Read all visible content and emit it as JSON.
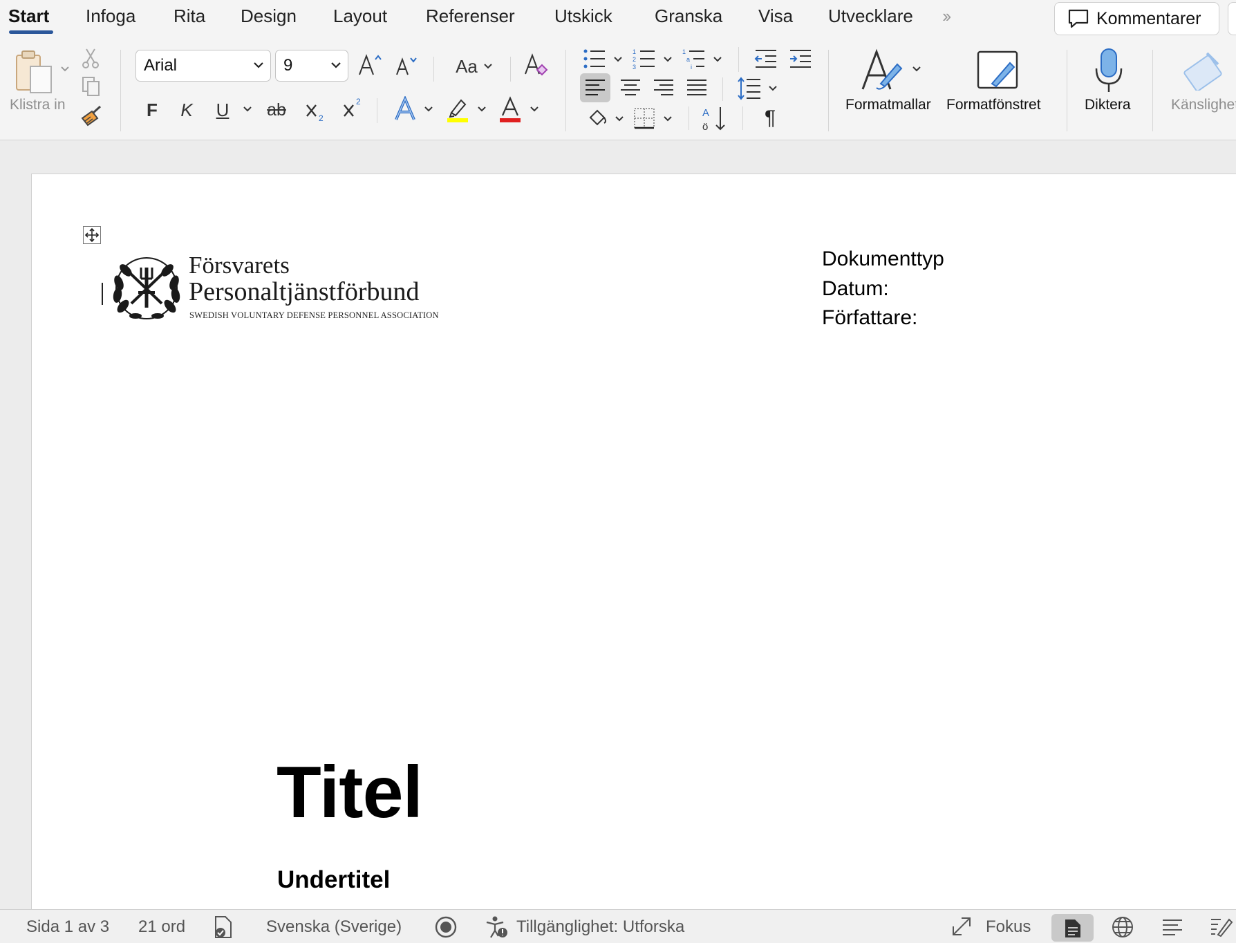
{
  "tabs": [
    {
      "label": "Start",
      "active": true
    },
    {
      "label": "Infoga"
    },
    {
      "label": "Rita"
    },
    {
      "label": "Design"
    },
    {
      "label": "Layout"
    },
    {
      "label": "Referenser"
    },
    {
      "label": "Utskick"
    },
    {
      "label": "Granska"
    },
    {
      "label": "Visa"
    },
    {
      "label": "Utvecklare"
    }
  ],
  "comments_label": "Kommentarer",
  "ribbon": {
    "paste_label": "Klistra in",
    "font_name": "Arial",
    "font_size": "9",
    "bold": "F",
    "italic": "K",
    "underline": "U",
    "strike": "ab",
    "case_label": "Aa",
    "styles_label": "Formatmallar",
    "styles_pane_label": "Formatfönstret",
    "dictate_label": "Diktera",
    "sensitivity_label": "Känslighet",
    "colors": {
      "highlight": "#ffff00",
      "font_color": "#e02020",
      "text_effect": "#2b6cc4",
      "accent": "#2b579a"
    }
  },
  "document": {
    "org_name_1": "Försvarets",
    "org_name_2": "Personaltjänstförbund",
    "org_subtitle": "SWEDISH VOLUNTARY DEFENSE PERSONNEL ASSOCIATION",
    "meta_doctype": "Dokumenttyp",
    "meta_date": "Datum:",
    "meta_author": "Författare:",
    "title": "Titel",
    "subtitle": "Undertitel"
  },
  "status": {
    "page": "Sida 1 av 3",
    "words": "21 ord",
    "language": "Svenska (Sverige)",
    "accessibility": "Tillgänglighet: Utforska",
    "focus": "Fokus"
  }
}
